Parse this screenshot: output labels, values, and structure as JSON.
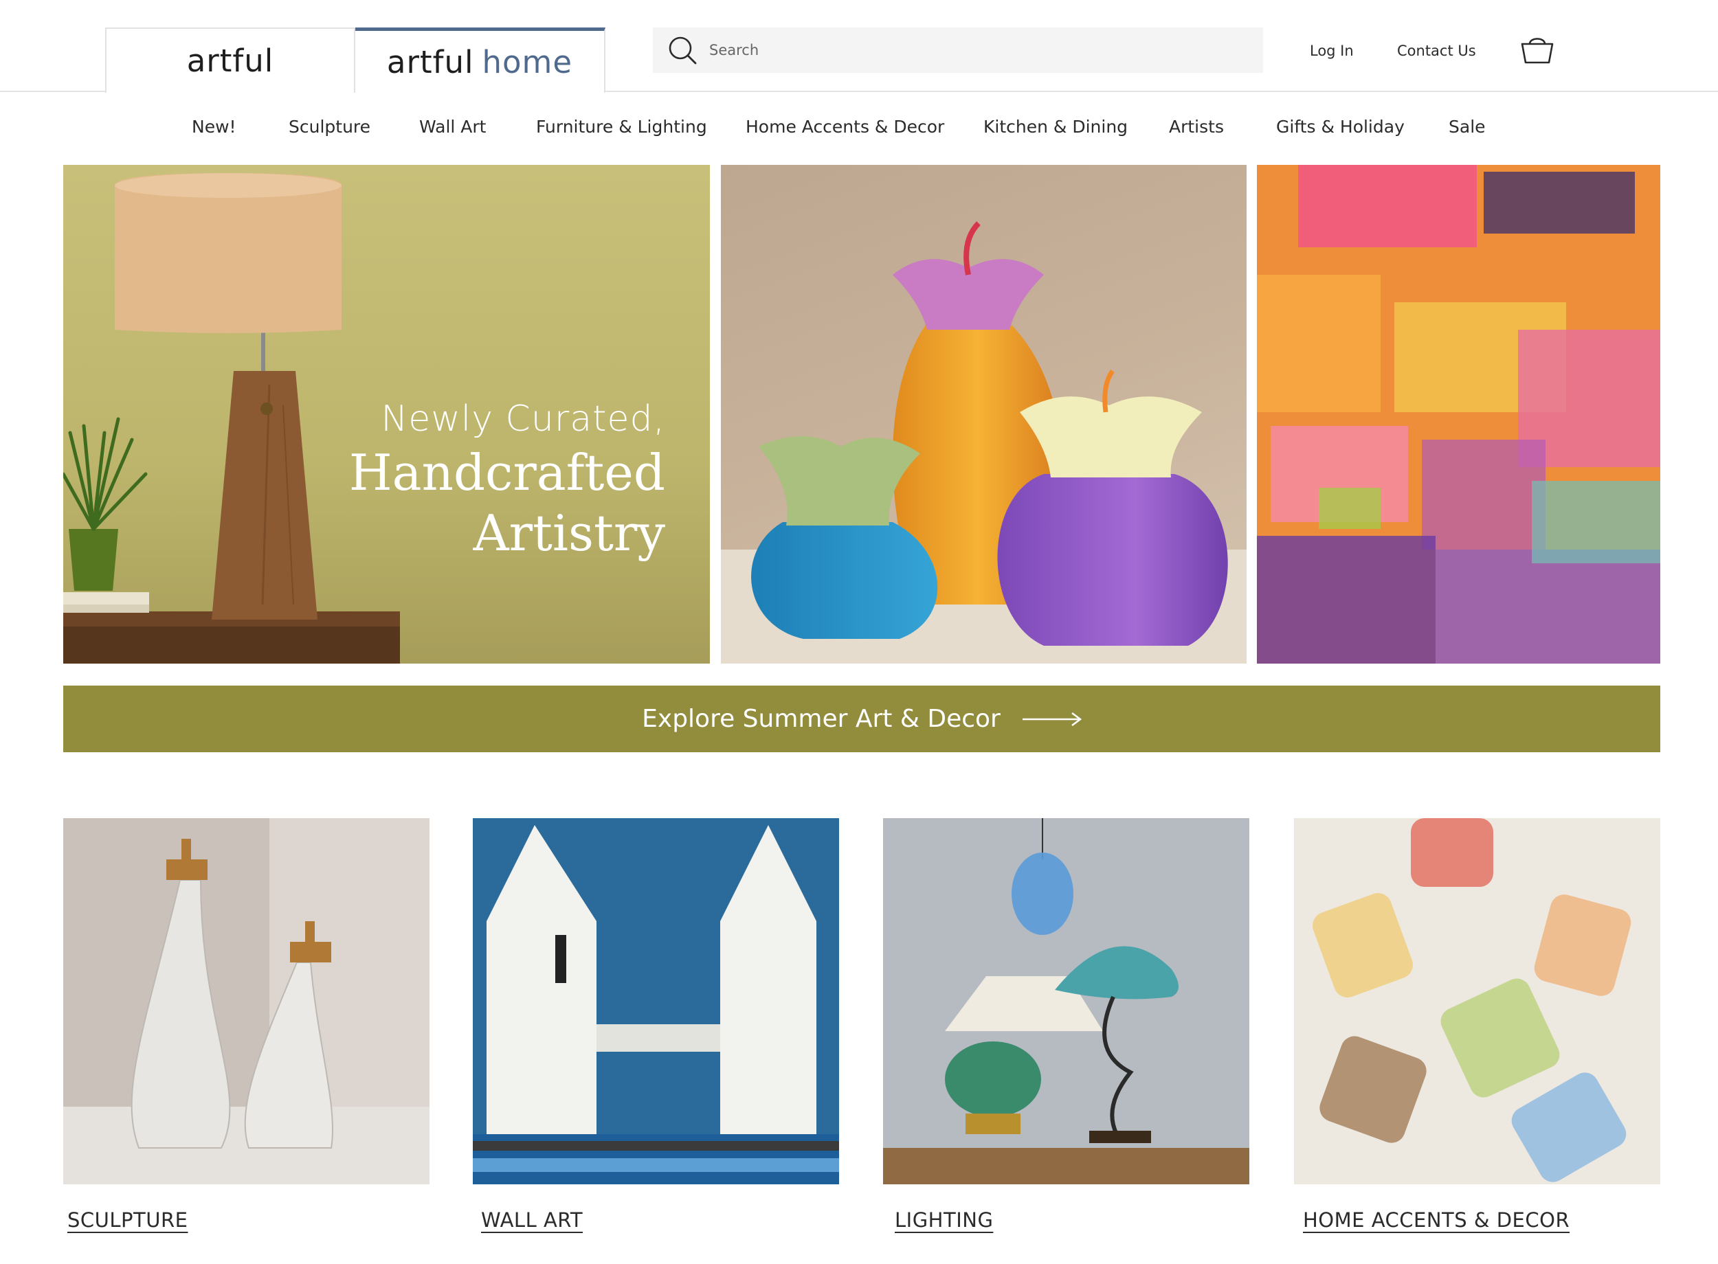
{
  "brand": {
    "tab_artful": "artful",
    "tab_home_prefix": "artful",
    "tab_home_accent": "home"
  },
  "search": {
    "placeholder": "Search"
  },
  "header_links": {
    "login": "Log In",
    "contact": "Contact Us"
  },
  "nav": [
    "New!",
    "Sculpture",
    "Wall Art",
    "Furniture & Lighting",
    "Home Accents & Decor",
    "Kitchen & Dining",
    "Artists",
    "Gifts & Holiday",
    "Sale"
  ],
  "hero": {
    "subtitle": "Newly Curated,",
    "title_line1": "Handcrafted",
    "title_line2": "Artistry"
  },
  "banner": {
    "label": "Explore Summer Art & Decor"
  },
  "categories": [
    {
      "label": "SCULPTURE"
    },
    {
      "label": "WALL ART"
    },
    {
      "label": "LIGHTING"
    },
    {
      "label": "HOME ACCENTS & DECOR"
    }
  ],
  "colors": {
    "brand_accent": "#4f6a8c",
    "banner": "#928c3d",
    "divider": "#e3e3e3"
  },
  "icons": [
    "search-icon",
    "cart-icon",
    "arrow-right-icon"
  ]
}
